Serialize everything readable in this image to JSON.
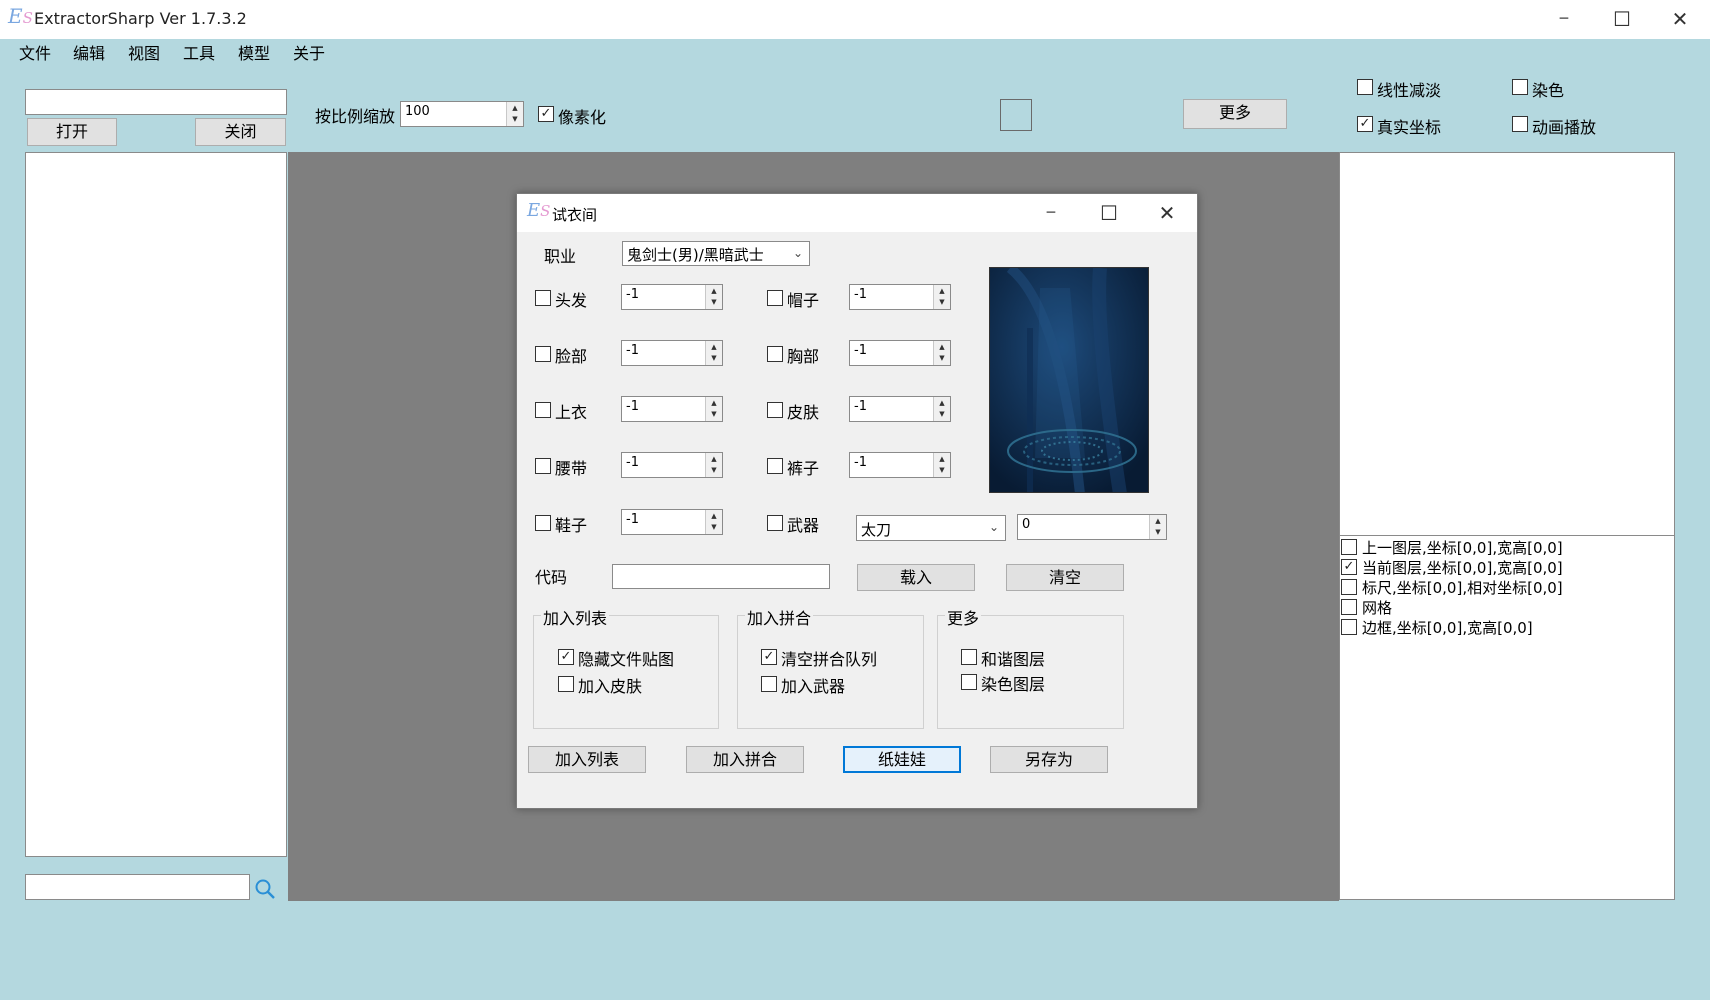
{
  "app": {
    "title": "ExtractorSharp Ver 1.7.3.2",
    "logo_e": "E",
    "logo_s": "S"
  },
  "window_controls": {
    "minimize": "─",
    "maximize": "☐",
    "close": "✕"
  },
  "menu": {
    "items": [
      "文件",
      "编辑",
      "视图",
      "工具",
      "模型",
      "关于"
    ]
  },
  "left": {
    "path_value": "",
    "open_label": "打开",
    "close_label": "关闭",
    "search_value": ""
  },
  "toolbar": {
    "scale_label": "按比例缩放",
    "scale_value": "100",
    "pixelate_label": "像素化",
    "pixelate_checked": true,
    "more_label": "更多",
    "linear_fade_label": "线性减淡",
    "linear_fade_checked": false,
    "dye_label": "染色",
    "dye_checked": false,
    "real_coords_label": "真实坐标",
    "real_coords_checked": true,
    "anim_play_label": "动画播放",
    "anim_play_checked": false
  },
  "layers": [
    {
      "label": "上一图层,坐标[0,0],宽高[0,0]",
      "checked": false
    },
    {
      "label": "当前图层,坐标[0,0],宽高[0,0]",
      "checked": true
    },
    {
      "label": "标尺,坐标[0,0],相对坐标[0,0]",
      "checked": false
    },
    {
      "label": "网格",
      "checked": false
    },
    {
      "label": "边框,坐标[0,0],宽高[0,0]",
      "checked": false
    }
  ],
  "dialog": {
    "title": "试衣间",
    "class_label": "职业",
    "class_value": "鬼剑士(男)/黑暗武士",
    "parts": [
      {
        "label": "头发",
        "value": "-1",
        "checked": false
      },
      {
        "label": "帽子",
        "value": "-1",
        "checked": false
      },
      {
        "label": "脸部",
        "value": "-1",
        "checked": false
      },
      {
        "label": "胸部",
        "value": "-1",
        "checked": false
      },
      {
        "label": "上衣",
        "value": "-1",
        "checked": false
      },
      {
        "label": "皮肤",
        "value": "-1",
        "checked": false
      },
      {
        "label": "腰带",
        "value": "-1",
        "checked": false
      },
      {
        "label": "裤子",
        "value": "-1",
        "checked": false
      },
      {
        "label": "鞋子",
        "value": "-1",
        "checked": false
      }
    ],
    "weapon": {
      "label": "武器",
      "checked": false,
      "type_value": "太刀",
      "value": "0"
    },
    "code_label": "代码",
    "code_value": "",
    "load_label": "载入",
    "clear_label": "清空",
    "group_add_list": {
      "title": "加入列表",
      "options": [
        {
          "label": "隐藏文件贴图",
          "checked": true
        },
        {
          "label": "加入皮肤",
          "checked": false
        }
      ]
    },
    "group_add_merge": {
      "title": "加入拼合",
      "options": [
        {
          "label": "清空拼合队列",
          "checked": true
        },
        {
          "label": "加入武器",
          "checked": false
        }
      ]
    },
    "group_more": {
      "title": "更多",
      "options": [
        {
          "label": "和谐图层",
          "checked": false
        },
        {
          "label": "染色图层",
          "checked": false
        }
      ]
    },
    "buttons": {
      "add_list": "加入列表",
      "add_merge": "加入拼合",
      "paper_doll": "纸娃娃",
      "save_as": "另存为"
    }
  }
}
